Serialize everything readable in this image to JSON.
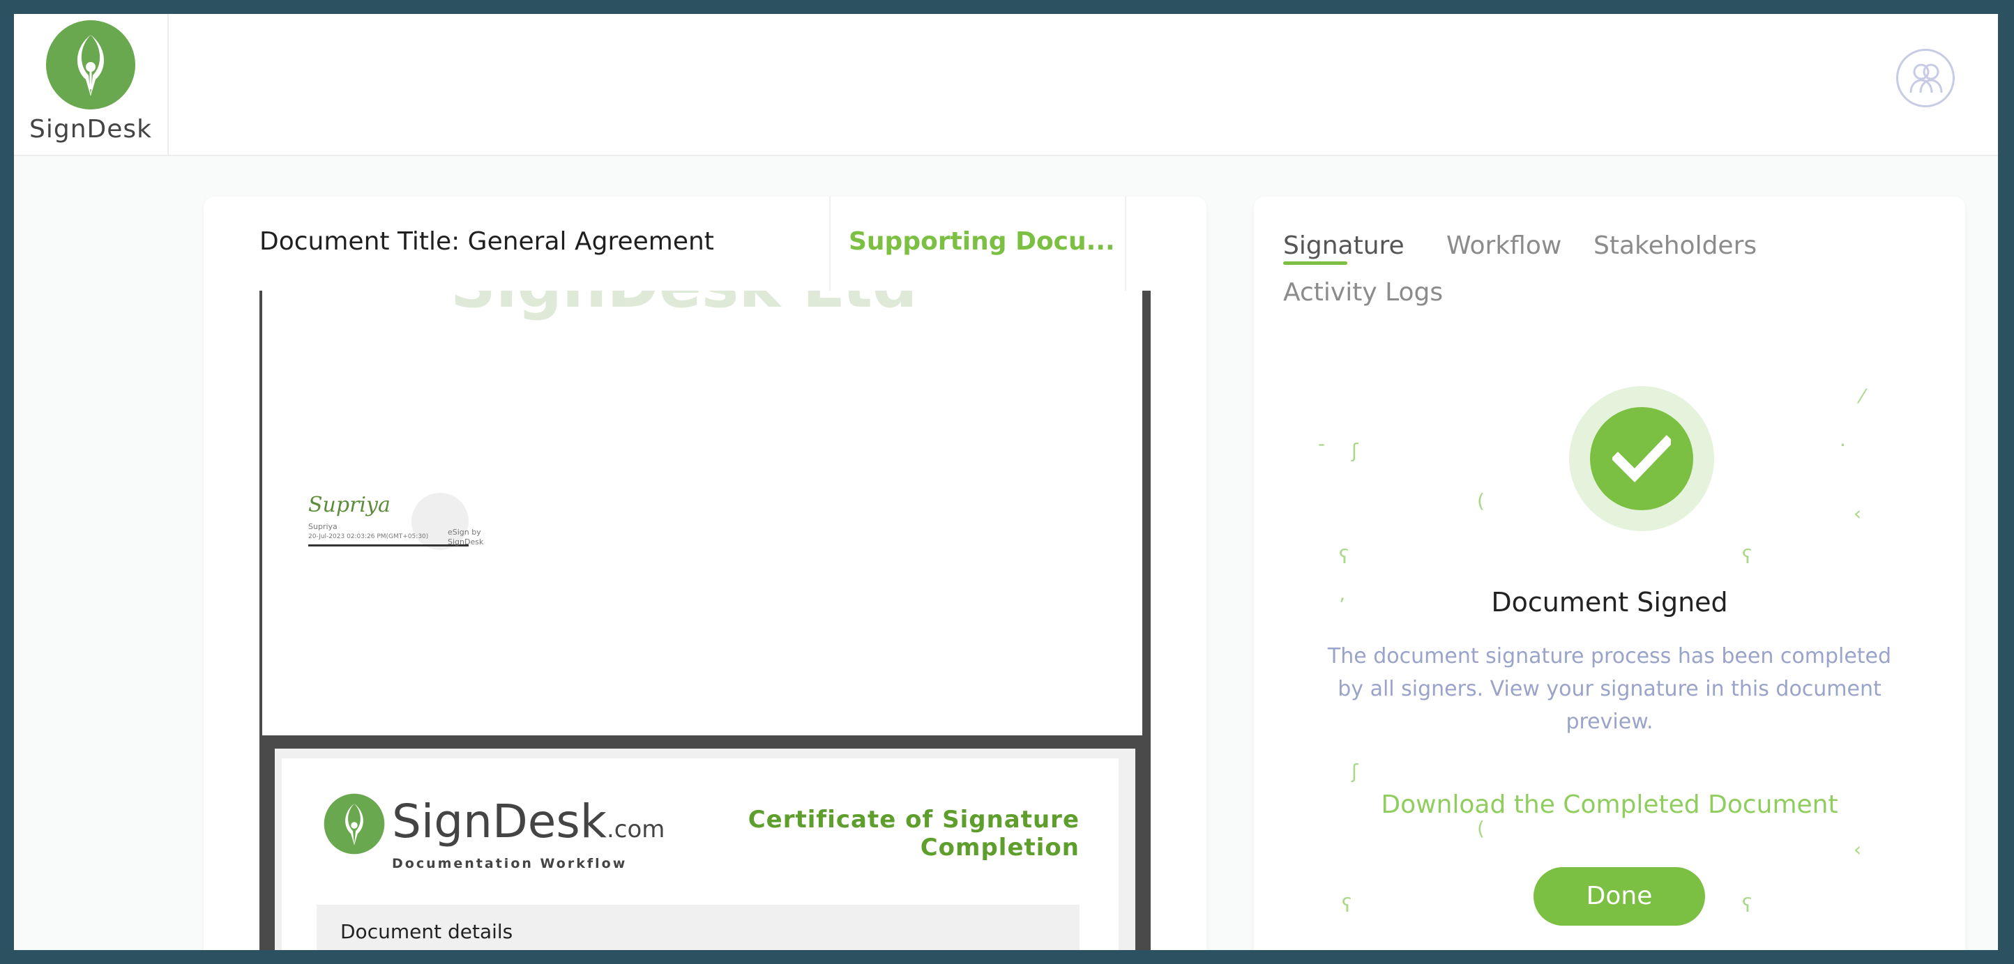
{
  "header": {
    "logo_text": "SignDesk"
  },
  "document": {
    "title": "Document Title: General Agreement",
    "supporting_tab_label": "Supporting Docu...",
    "page1": {
      "watermark_text": "SignDesk Ltd",
      "signer_name": "Supriya",
      "signer_sub": "Supriya",
      "signer_date": "20-Jul-2023 02:03:26 PM(GMT+05:30)",
      "esign_by": "eSign by",
      "esign_brand": "SignDesk"
    },
    "page2": {
      "logo_text": "SignDesk",
      "logo_suffix": ".com",
      "logo_subtitle": "Documentation Workflow",
      "certificate_title": "Certificate of Signature Completion",
      "section_heading": "Document details"
    }
  },
  "right_panel": {
    "tabs": [
      {
        "label": "Signature",
        "active": true
      },
      {
        "label": "Workflow",
        "active": false
      },
      {
        "label": "Stakeholders",
        "active": false
      },
      {
        "label": "Activity Logs",
        "active": false
      }
    ],
    "status_title": "Document Signed",
    "status_description": "The document signature process has been completed by all signers. View your signature in this document preview.",
    "download_link": "Download the Completed Document",
    "done_button": "Done"
  },
  "colors": {
    "brand_green": "#7cc043",
    "frame_border": "#2c5262",
    "desc_text": "#9aa3c9"
  }
}
